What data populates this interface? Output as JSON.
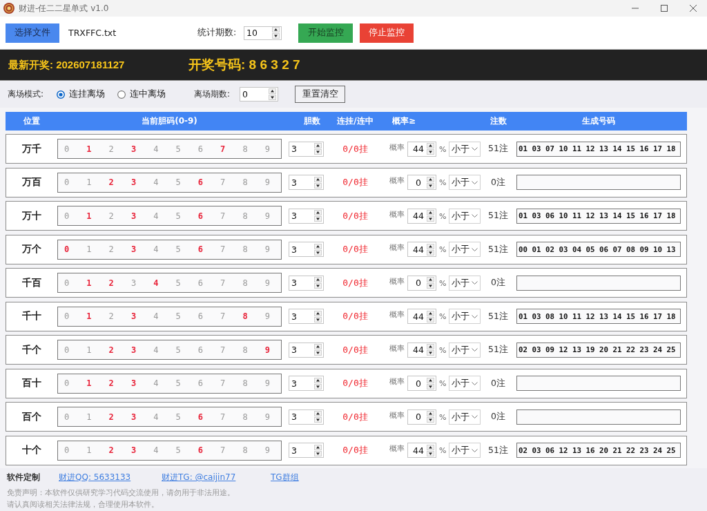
{
  "window": {
    "title": "财进-任二二星单式 v1.0"
  },
  "toolbar": {
    "select_file_button": "选择文件",
    "file_name": "TRXFFC.txt",
    "period_label": "统计期数:",
    "period_value": "10",
    "start_button": "开始监控",
    "stop_button": "停止监控"
  },
  "banner": {
    "latest_draw": "最新开奖: 202607181127",
    "winning_numbers": "开奖号码: 8 6 3 2 7"
  },
  "options": {
    "mode_label": "离场模式:",
    "modes": [
      {
        "label": "连挂离场",
        "selected": true
      },
      {
        "label": "连中离场",
        "selected": false
      }
    ],
    "exit_periods_label": "离场期数:",
    "exit_periods_value": "0",
    "reset_button": "重置清空"
  },
  "table": {
    "columns": [
      "位置",
      "当前胆码(0-9)",
      "胆数",
      "连挂/连中",
      "概率≥",
      "注数",
      "生成号码"
    ],
    "rows": [
      {
        "position": "万千",
        "digits": [
          {
            "digit": "0",
            "hot": false
          },
          {
            "digit": "1",
            "hot": true
          },
          {
            "digit": "2",
            "hot": false
          },
          {
            "digit": "3",
            "hot": true
          },
          {
            "digit": "4",
            "hot": false
          },
          {
            "digit": "5",
            "hot": false
          },
          {
            "digit": "6",
            "hot": false
          },
          {
            "digit": "7",
            "hot": true
          },
          {
            "digit": "8",
            "hot": false
          },
          {
            "digit": "9",
            "hot": false
          }
        ],
        "count": "3",
        "streak": "0/0挂",
        "rate_label": "概率",
        "rate": "44",
        "percent": "%",
        "comparison": "小于",
        "bets": "51注",
        "numbers": "01 03 07 10 11 12 13 14 15 16 17 18"
      },
      {
        "position": "万百",
        "digits": [
          {
            "digit": "0",
            "hot": false
          },
          {
            "digit": "1",
            "hot": false
          },
          {
            "digit": "2",
            "hot": true
          },
          {
            "digit": "3",
            "hot": true
          },
          {
            "digit": "4",
            "hot": false
          },
          {
            "digit": "5",
            "hot": false
          },
          {
            "digit": "6",
            "hot": true
          },
          {
            "digit": "7",
            "hot": false
          },
          {
            "digit": "8",
            "hot": false
          },
          {
            "digit": "9",
            "hot": false
          }
        ],
        "count": "3",
        "streak": "0/0挂",
        "rate_label": "概率",
        "rate": "0",
        "percent": "%",
        "comparison": "小于",
        "bets": "0注"
      },
      {
        "position": "万十",
        "digits": [
          {
            "digit": "0",
            "hot": false
          },
          {
            "digit": "1",
            "hot": true
          },
          {
            "digit": "2",
            "hot": false
          },
          {
            "digit": "3",
            "hot": true
          },
          {
            "digit": "4",
            "hot": false
          },
          {
            "digit": "5",
            "hot": false
          },
          {
            "digit": "6",
            "hot": true
          },
          {
            "digit": "7",
            "hot": false
          },
          {
            "digit": "8",
            "hot": false
          },
          {
            "digit": "9",
            "hot": false
          }
        ],
        "count": "3",
        "streak": "0/0挂",
        "rate_label": "概率",
        "rate": "44",
        "percent": "%",
        "comparison": "小于",
        "bets": "51注",
        "numbers": "01 03 06 10 11 12 13 14 15 16 17 18"
      },
      {
        "position": "万个",
        "digits": [
          {
            "digit": "0",
            "hot": true
          },
          {
            "digit": "1",
            "hot": false
          },
          {
            "digit": "2",
            "hot": false
          },
          {
            "digit": "3",
            "hot": true
          },
          {
            "digit": "4",
            "hot": false
          },
          {
            "digit": "5",
            "hot": false
          },
          {
            "digit": "6",
            "hot": true
          },
          {
            "digit": "7",
            "hot": false
          },
          {
            "digit": "8",
            "hot": false
          },
          {
            "digit": "9",
            "hot": false
          }
        ],
        "count": "3",
        "streak": "0/0挂",
        "rate_label": "概率",
        "rate": "44",
        "percent": "%",
        "comparison": "小于",
        "bets": "51注",
        "numbers": "00 01 02 03 04 05 06 07 08 09 10 13"
      },
      {
        "position": "千百",
        "digits": [
          {
            "digit": "0",
            "hot": false
          },
          {
            "digit": "1",
            "hot": true
          },
          {
            "digit": "2",
            "hot": true
          },
          {
            "digit": "3",
            "hot": false
          },
          {
            "digit": "4",
            "hot": true
          },
          {
            "digit": "5",
            "hot": false
          },
          {
            "digit": "6",
            "hot": false
          },
          {
            "digit": "7",
            "hot": false
          },
          {
            "digit": "8",
            "hot": false
          },
          {
            "digit": "9",
            "hot": false
          }
        ],
        "count": "3",
        "streak": "0/0挂",
        "rate_label": "概率",
        "rate": "0",
        "percent": "%",
        "comparison": "小于",
        "bets": "0注"
      },
      {
        "position": "千十",
        "digits": [
          {
            "digit": "0",
            "hot": false
          },
          {
            "digit": "1",
            "hot": true
          },
          {
            "digit": "2",
            "hot": false
          },
          {
            "digit": "3",
            "hot": true
          },
          {
            "digit": "4",
            "hot": false
          },
          {
            "digit": "5",
            "hot": false
          },
          {
            "digit": "6",
            "hot": false
          },
          {
            "digit": "7",
            "hot": false
          },
          {
            "digit": "8",
            "hot": true
          },
          {
            "digit": "9",
            "hot": false
          }
        ],
        "count": "3",
        "streak": "0/0挂",
        "rate_label": "概率",
        "rate": "44",
        "percent": "%",
        "comparison": "小于",
        "bets": "51注",
        "numbers": "01 03 08 10 11 12 13 14 15 16 17 18"
      },
      {
        "position": "千个",
        "digits": [
          {
            "digit": "0",
            "hot": false
          },
          {
            "digit": "1",
            "hot": false
          },
          {
            "digit": "2",
            "hot": true
          },
          {
            "digit": "3",
            "hot": true
          },
          {
            "digit": "4",
            "hot": false
          },
          {
            "digit": "5",
            "hot": false
          },
          {
            "digit": "6",
            "hot": false
          },
          {
            "digit": "7",
            "hot": false
          },
          {
            "digit": "8",
            "hot": false
          },
          {
            "digit": "9",
            "hot": true
          }
        ],
        "count": "3",
        "streak": "0/0挂",
        "rate_label": "概率",
        "rate": "44",
        "percent": "%",
        "comparison": "小于",
        "bets": "51注",
        "numbers": "02 03 09 12 13 19 20 21 22 23 24 25"
      },
      {
        "position": "百十",
        "digits": [
          {
            "digit": "0",
            "hot": false
          },
          {
            "digit": "1",
            "hot": true
          },
          {
            "digit": "2",
            "hot": true
          },
          {
            "digit": "3",
            "hot": true
          },
          {
            "digit": "4",
            "hot": false
          },
          {
            "digit": "5",
            "hot": false
          },
          {
            "digit": "6",
            "hot": false
          },
          {
            "digit": "7",
            "hot": false
          },
          {
            "digit": "8",
            "hot": false
          },
          {
            "digit": "9",
            "hot": false
          }
        ],
        "count": "3",
        "streak": "0/0挂",
        "rate_label": "概率",
        "rate": "0",
        "percent": "%",
        "comparison": "小于",
        "bets": "0注"
      },
      {
        "position": "百个",
        "digits": [
          {
            "digit": "0",
            "hot": false
          },
          {
            "digit": "1",
            "hot": false
          },
          {
            "digit": "2",
            "hot": true
          },
          {
            "digit": "3",
            "hot": true
          },
          {
            "digit": "4",
            "hot": false
          },
          {
            "digit": "5",
            "hot": false
          },
          {
            "digit": "6",
            "hot": true
          },
          {
            "digit": "7",
            "hot": false
          },
          {
            "digit": "8",
            "hot": false
          },
          {
            "digit": "9",
            "hot": false
          }
        ],
        "count": "3",
        "streak": "0/0挂",
        "rate_label": "概率",
        "rate": "0",
        "percent": "%",
        "comparison": "小于",
        "bets": "0注"
      },
      {
        "position": "十个",
        "digits": [
          {
            "digit": "0",
            "hot": false
          },
          {
            "digit": "1",
            "hot": false
          },
          {
            "digit": "2",
            "hot": true
          },
          {
            "digit": "3",
            "hot": true
          },
          {
            "digit": "4",
            "hot": false
          },
          {
            "digit": "5",
            "hot": false
          },
          {
            "digit": "6",
            "hot": true
          },
          {
            "digit": "7",
            "hot": false
          },
          {
            "digit": "8",
            "hot": false
          },
          {
            "digit": "9",
            "hot": false
          }
        ],
        "count": "3",
        "streak": "0/0挂",
        "rate_label": "概率",
        "rate": "44",
        "percent": "%",
        "comparison": "小于",
        "bets": "51注",
        "numbers": "02 03 06 12 13 16 20 21 22 23 24 25"
      }
    ]
  },
  "footer": {
    "custom_label": "软件定制",
    "links": [
      "财进QQ: 5633133",
      "财进TG: @caijin77",
      "TG群组"
    ],
    "disclaimer": [
      "免责声明：本软件仅供研究学习代码交流使用，请勿用于非法用途。",
      "请认真阅读相关法律法规，合理使用本软件。"
    ]
  }
}
